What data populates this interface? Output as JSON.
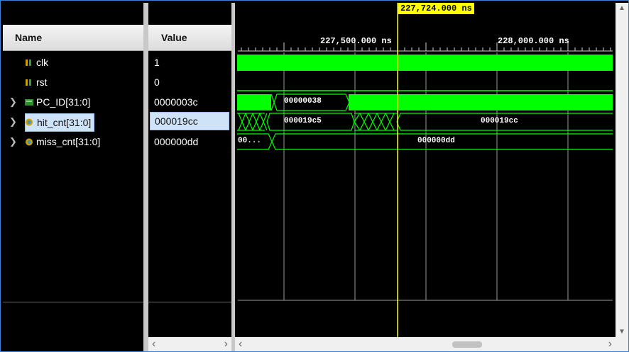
{
  "panels": {
    "name_header": "Name",
    "value_header": "Value"
  },
  "signals": [
    {
      "name": "clk",
      "value": "1",
      "icon": "bit-signal-icon",
      "expandable": false
    },
    {
      "name": "rst",
      "value": "0",
      "icon": "bit-signal-icon",
      "expandable": false
    },
    {
      "name": "PC_ID[31:0]",
      "value": "0000003c",
      "icon": "bus-signal-icon",
      "expandable": true
    },
    {
      "name": "hit_cnt[31:0]",
      "value": "000019cc",
      "icon": "counter-signal-icon",
      "expandable": true,
      "selected": true
    },
    {
      "name": "miss_cnt[31:0]",
      "value": "000000dd",
      "icon": "counter-signal-icon",
      "expandable": true
    }
  ],
  "waveform": {
    "cursor_time": "227,724.000 ns",
    "ruler_labels": [
      "227,500.000 ns",
      "228,000.000 ns"
    ],
    "pc_id_value": "00000038",
    "hit_cnt_values": [
      "000019c5",
      "000019cc"
    ],
    "miss_cnt_values": [
      "00...",
      "000000dd"
    ],
    "colors": {
      "signal": "#00ff00",
      "cursor": "#ffff00",
      "grid": "#9a9a9a",
      "background": "#000000"
    }
  }
}
